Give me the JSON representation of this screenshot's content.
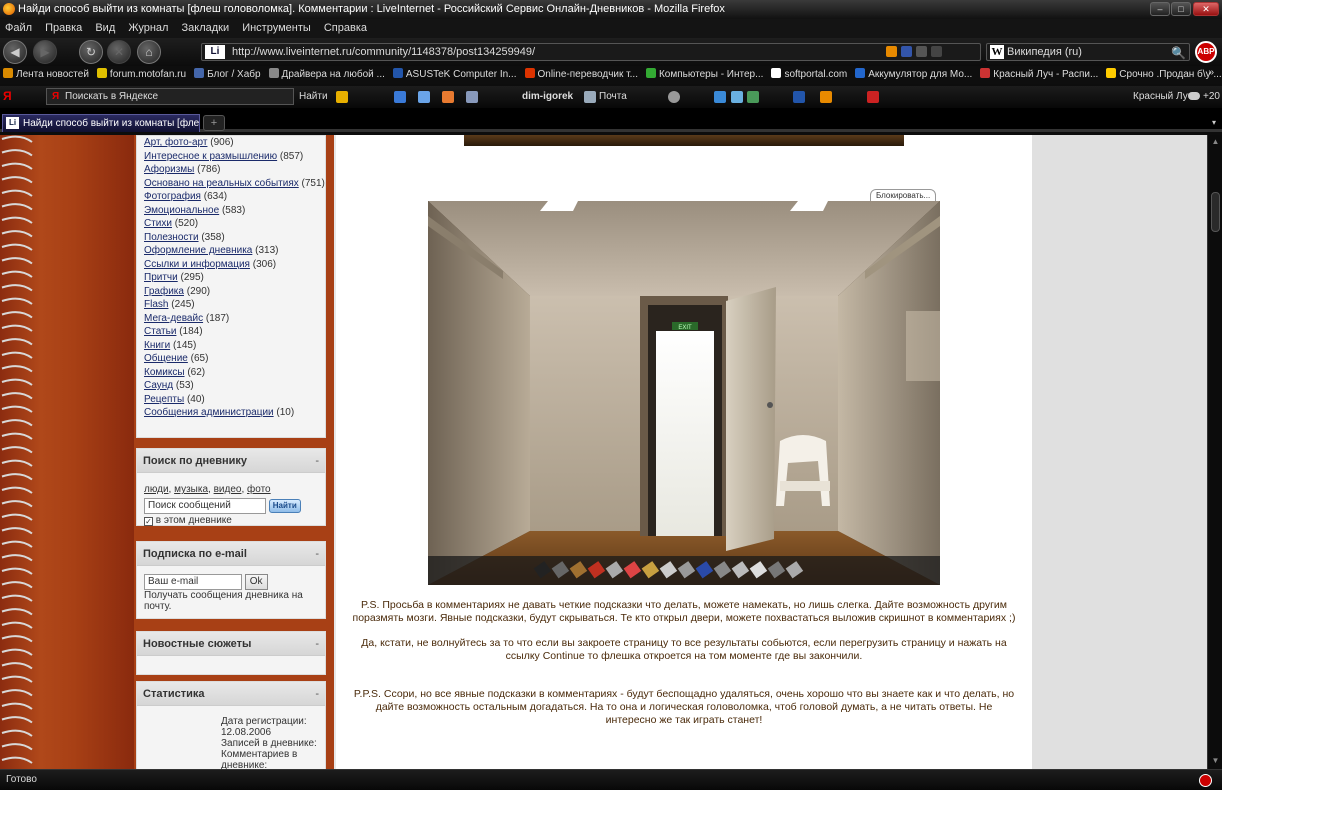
{
  "window": {
    "title": "Найди способ выйти из комнаты [флеш головоломка]. Комментарии : LiveInternet - Российский Сервис Онлайн-Дневников - Mozilla Firefox",
    "minimize": "–",
    "maximize": "□",
    "close": "✕"
  },
  "menu": [
    "Файл",
    "Правка",
    "Вид",
    "Журнал",
    "Закладки",
    "Инструменты",
    "Справка"
  ],
  "nav": {
    "back_icon": "◀",
    "forward_icon": "▶",
    "reload_icon": "↻",
    "stop_icon": "✕",
    "home_icon": "⌂",
    "site_badge": "Li",
    "url": "http://www.liveinternet.ru/community/1148378/post134259949/",
    "search_engine_badge": "W",
    "search_placeholder": "Википедия (ru)",
    "search_icon": "🔍",
    "abp_label": "ABP"
  },
  "bookmarks": {
    "items": [
      {
        "label": "Лента новостей",
        "color": "#d98a00"
      },
      {
        "label": "forum.motofan.ru",
        "color": "#e0c000"
      },
      {
        "label": "Блог / Хабр",
        "color": "#4466aa"
      },
      {
        "label": "Драйвера на любой ...",
        "color": "#888888"
      },
      {
        "label": "ASUSTeK Computer In...",
        "color": "#2255aa"
      },
      {
        "label": "Online-переводчик т...",
        "color": "#dd3300"
      },
      {
        "label": "Компьютеры - Интер...",
        "color": "#33aa33"
      },
      {
        "label": "softportal.com",
        "color": "#ffffff"
      },
      {
        "label": "Аккумулятор для Мо...",
        "color": "#2266cc"
      },
      {
        "label": "Красный Луч - Распи...",
        "color": "#cc3333"
      },
      {
        "label": "Срочно .Продан б\\у ...",
        "color": "#ffcc00"
      }
    ],
    "more": "»"
  },
  "yandex_bar": {
    "logo": "Я",
    "input_text": "Поискать в Яндексе",
    "find": "Найти",
    "user": "dim-igorek",
    "mail": "Почта",
    "weather": "Красный Луч",
    "temp": "+20"
  },
  "tab": {
    "badge": "Li",
    "title": "Найди способ выйти из комнаты [флеш г...",
    "new_tab": "+",
    "list_icon": "▾"
  },
  "sidebar": {
    "categories": [
      {
        "name": "Арт, фото-арт",
        "count": "(906)"
      },
      {
        "name": "Интересное к размышлению",
        "count": "(857)"
      },
      {
        "name": "Афоризмы",
        "count": "(786)"
      },
      {
        "name": "Основано на реальных событиях",
        "count": "(751)"
      },
      {
        "name": "Фотография",
        "count": "(634)"
      },
      {
        "name": "Эмоциональное",
        "count": "(583)"
      },
      {
        "name": "Стихи",
        "count": "(520)"
      },
      {
        "name": "Полезности",
        "count": "(358)"
      },
      {
        "name": "Оформление дневника",
        "count": "(313)"
      },
      {
        "name": "Ссылки и информация",
        "count": "(306)"
      },
      {
        "name": "Притчи",
        "count": "(295)"
      },
      {
        "name": "Графика",
        "count": "(290)"
      },
      {
        "name": "Flash",
        "count": "(245)"
      },
      {
        "name": "Мега-девайс",
        "count": "(187)"
      },
      {
        "name": "Статьи",
        "count": "(184)"
      },
      {
        "name": "Книги",
        "count": "(145)"
      },
      {
        "name": "Общение",
        "count": "(65)"
      },
      {
        "name": "Комиксы",
        "count": "(62)"
      },
      {
        "name": "Саунд",
        "count": "(53)"
      },
      {
        "name": "Рецепты",
        "count": "(40)"
      },
      {
        "name": "Сообщения администрации",
        "count": "(10)"
      }
    ],
    "search": {
      "title": "Поиск по дневнику",
      "collapse": "-",
      "links": [
        "люди",
        "музыка",
        "видео",
        "фото"
      ],
      "input": "Поиск сообщений",
      "button": "Найти",
      "checkbox_label": "в этом дневнике"
    },
    "subscribe": {
      "title": "Подписка по e-mail",
      "collapse": "-",
      "input": "Ваш e-mail",
      "button": "Ok",
      "note": "Получать сообщения дневника на почту."
    },
    "news": {
      "title": "Новостные сюжеты",
      "collapse": "-"
    },
    "stats": {
      "title": "Статистика",
      "collapse": "-",
      "reg_label": "Дата регистрации:",
      "reg_date": "12.08.2006",
      "posts": "Записей в дневнике:",
      "comments": "Комментариев в дневнике:"
    }
  },
  "post": {
    "block_button": "Блокировать...",
    "exit_sign": "EXIT",
    "ps": "P.S. Просьба в комментариях не давать четкие подсказки что делать, можете намекать, но лишь слегка. Дайте возможность другим поразмять мозги. Явные подсказки, будут скрываться. Те кто открыл двери, можете похвастаться выложив скришнот в комментариях ;)",
    "note": "Да, кстати, не волнуйтесь за то что если вы закроете страницу то все результаты собьются, если перегрузить страницу и нажать на ссылку Continue то флешка откроется на том моменте где вы закончили.",
    "pps": "P.P.S. Ссори, но все явные подсказки в комментариях - будут беспощадно удаляться, очень хорошо что вы знаете как и что делать, но дайте возможность остальным догадаться. На то она и логическая головоломка, чтоб головой думать, а не читать ответы. Не интересно же так играть станет!"
  },
  "status": {
    "text": "Готово"
  },
  "colors": {
    "leather": "#a84015",
    "link": "#1a2a6a",
    "post_text": "#4a2a0a"
  }
}
